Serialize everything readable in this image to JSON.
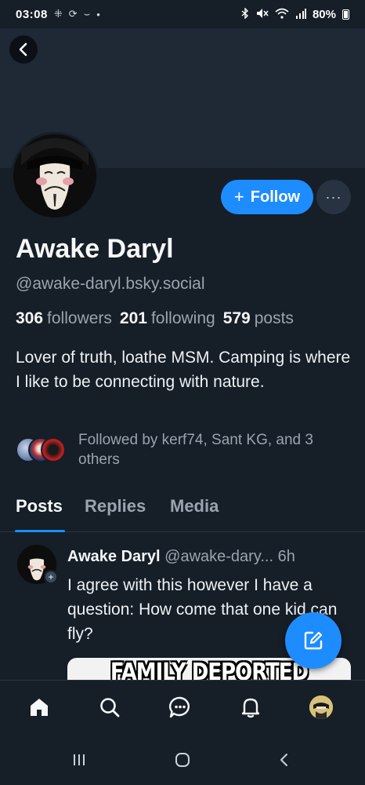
{
  "status_bar": {
    "time": "03:08",
    "battery": "80%",
    "left_icons": [
      "grid-dots-icon",
      "sync-icon",
      "minus-icon",
      "dot-icon"
    ],
    "right_icons": [
      "bluetooth-icon",
      "mute-icon",
      "wifi-icon",
      "signal-icon",
      "battery-icon"
    ]
  },
  "profile": {
    "display_name": "Awake Daryl",
    "handle": "@awake-daryl.bsky.social",
    "followers_count": "306",
    "followers_label": "followers",
    "following_count": "201",
    "following_label": "following",
    "posts_count": "579",
    "posts_label": "posts",
    "bio": "Lover of truth, loathe MSM. Camping is where I like to be connecting with nature.",
    "followed_by": "Followed by kerf74, Sant KG, and 3 others"
  },
  "actions": {
    "follow_label": "Follow",
    "follow_icon": "+",
    "more_label": "···"
  },
  "tabs": [
    {
      "label": "Posts",
      "active": true
    },
    {
      "label": "Replies",
      "active": false
    },
    {
      "label": "Media",
      "active": false
    }
  ],
  "post": {
    "author": "Awake Daryl",
    "handle_truncated": "@awake-dary...",
    "age": "6h",
    "text": "I agree with this however I have a question: How come that one kid can fly?",
    "image_caption": "FAMILY DEPORTED TOGETHER"
  },
  "bottom_nav": [
    "home-icon",
    "search-icon",
    "chat-icon",
    "bell-icon",
    "profile-avatar"
  ],
  "colors": {
    "background": "#161e27",
    "banner": "#1e2935",
    "accent": "#1d8cff",
    "muted_text": "#99a4b1"
  }
}
